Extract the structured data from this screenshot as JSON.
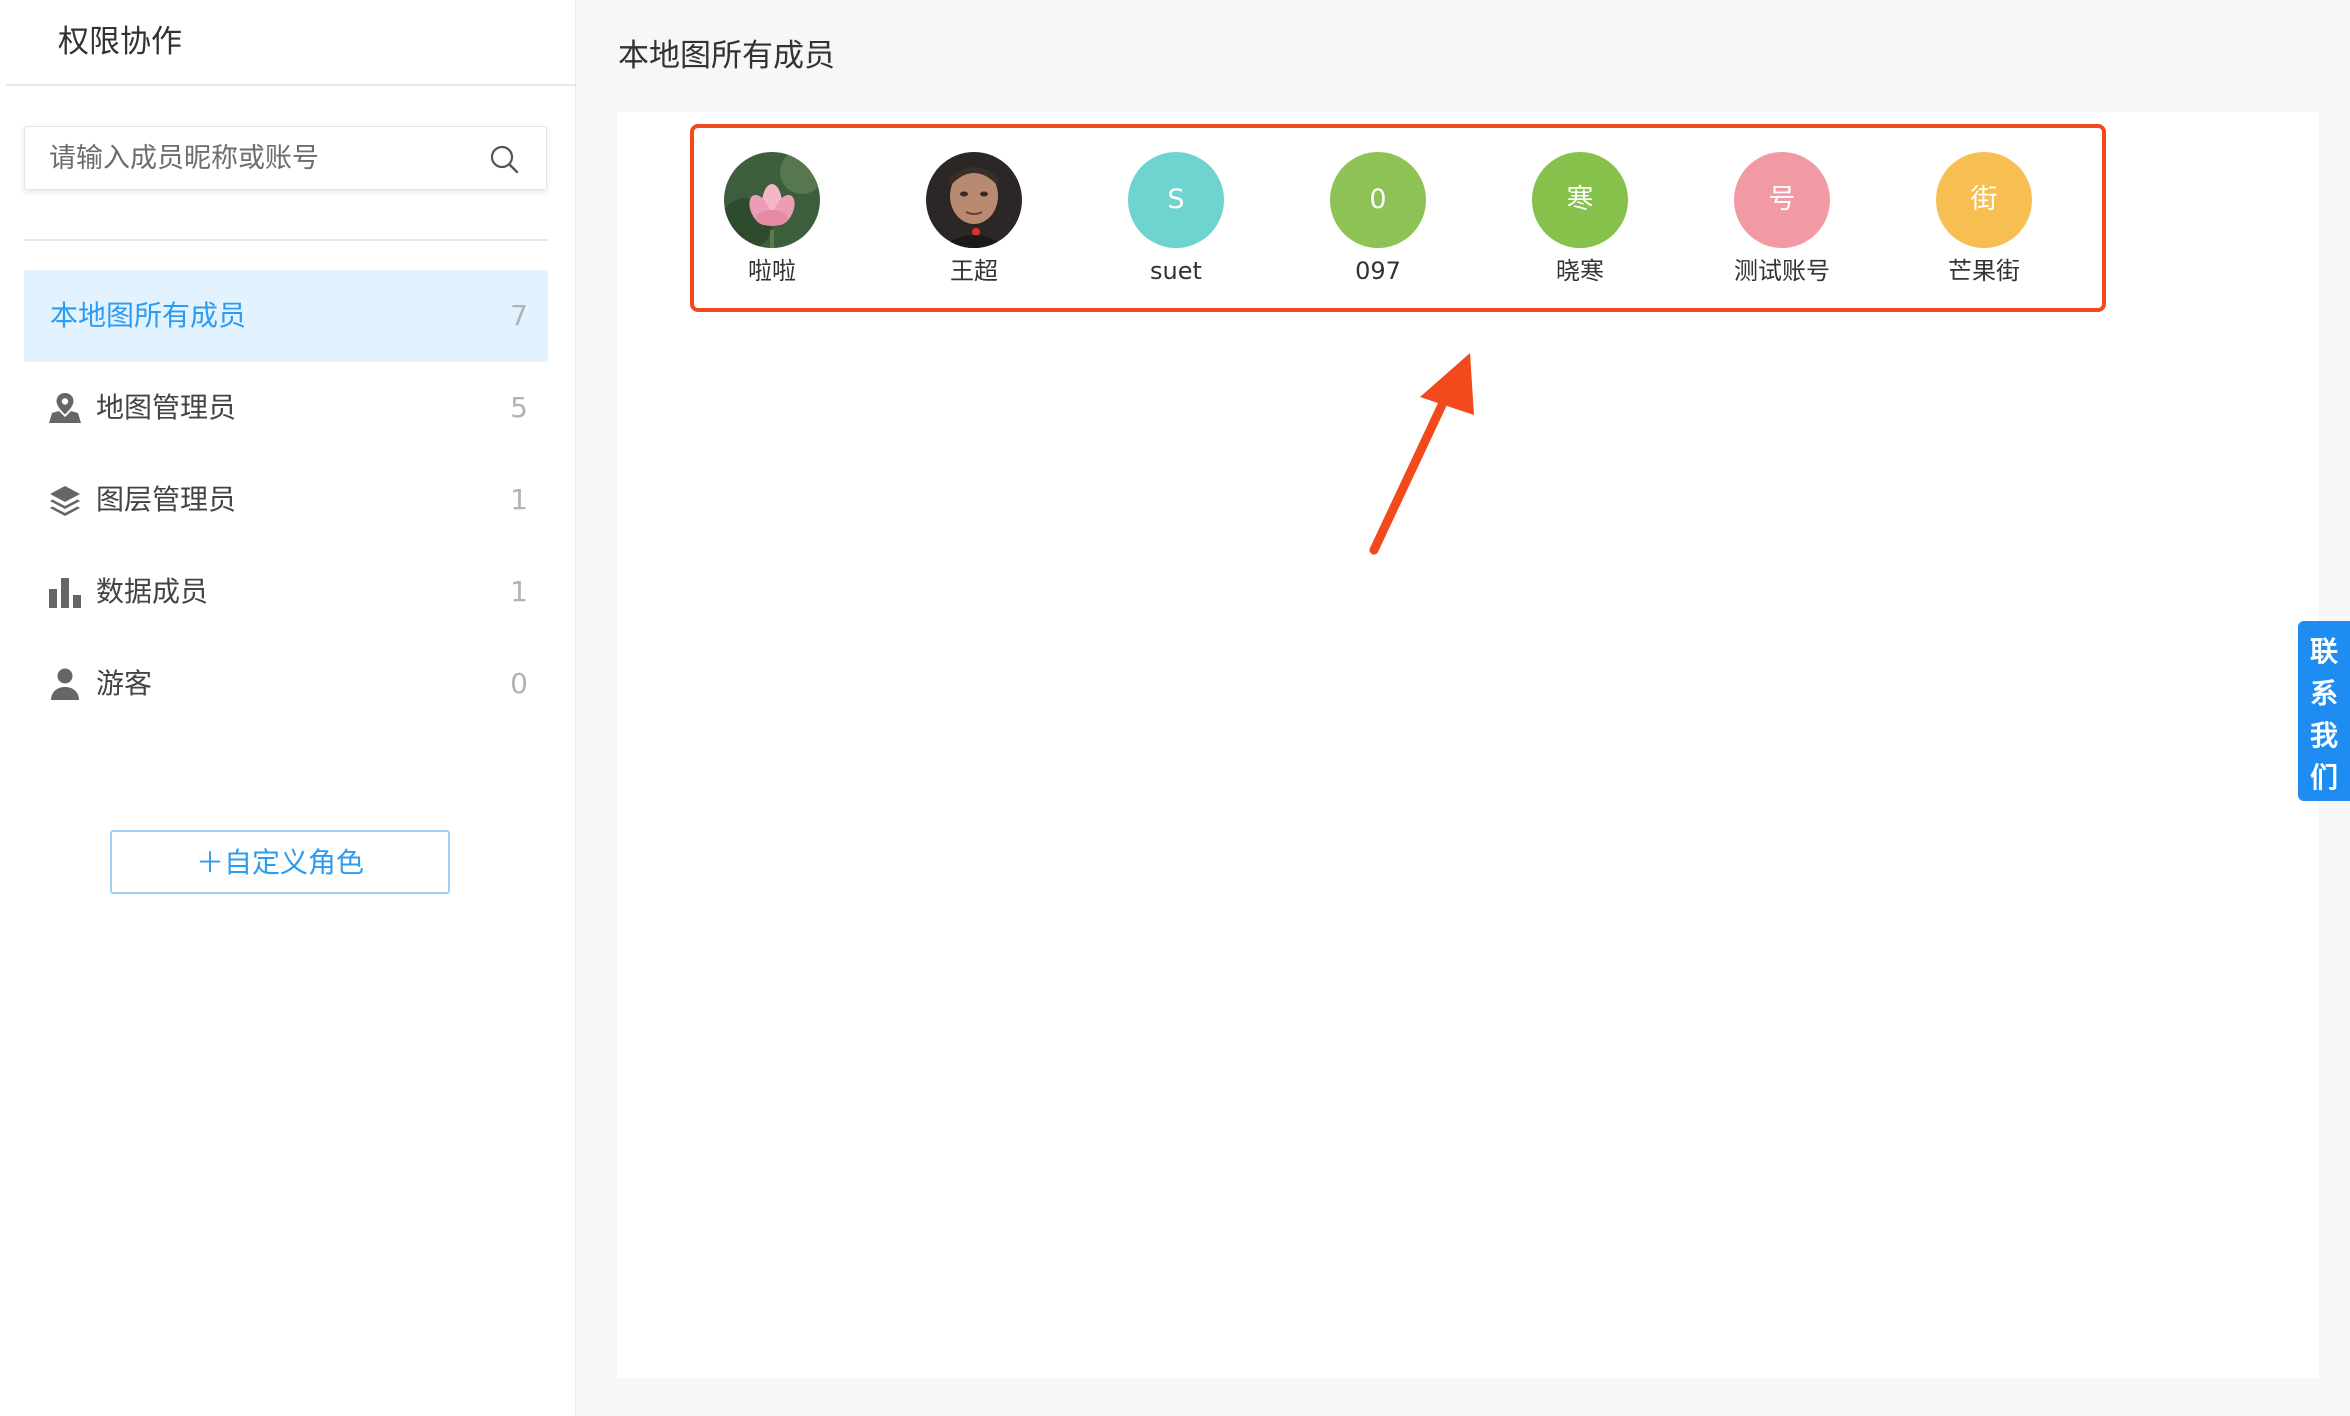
{
  "sidebar": {
    "title": "权限协作",
    "search": {
      "placeholder": "请输入成员昵称或账号",
      "value": ""
    },
    "roles": [
      {
        "label": "本地图所有成员",
        "count": "7",
        "icon": "none",
        "active": true
      },
      {
        "label": "地图管理员",
        "count": "5",
        "icon": "map-user-icon"
      },
      {
        "label": "图层管理员",
        "count": "1",
        "icon": "layers-icon"
      },
      {
        "label": "数据成员",
        "count": "1",
        "icon": "bar-chart-icon"
      },
      {
        "label": "游客",
        "count": "0",
        "icon": "person-icon"
      }
    ],
    "custom_role_label": "＋自定义角色"
  },
  "main": {
    "title": "本地图所有成员",
    "members": [
      {
        "name": "啦啦",
        "avatar_type": "image",
        "avatar_icon": "lotus-photo"
      },
      {
        "name": "王超",
        "avatar_type": "image",
        "avatar_icon": "face-photo"
      },
      {
        "name": "suet",
        "avatar_text": "S",
        "color": "#6fd3cf"
      },
      {
        "name": "097",
        "avatar_text": "0",
        "color": "#8ec255"
      },
      {
        "name": "晓寒",
        "avatar_text": "寒",
        "color": "#86c14b"
      },
      {
        "name": "测试账号",
        "avatar_text": "号",
        "color": "#f29aa4"
      },
      {
        "name": "芒果街",
        "avatar_text": "街",
        "color": "#f7be52"
      }
    ]
  },
  "contact_tab": {
    "chars": [
      "联",
      "系",
      "我",
      "们"
    ],
    "color": "#1e8cf0"
  },
  "annotation": {
    "box_color": "#f24a1c",
    "arrow_color": "#f24a1c"
  }
}
